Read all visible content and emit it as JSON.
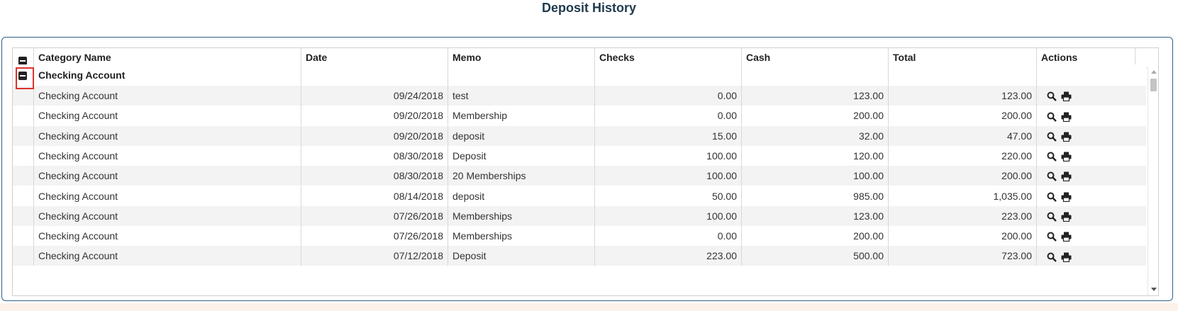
{
  "page": {
    "title": "Deposit History"
  },
  "grid": {
    "columns": {
      "category": "Category Name",
      "date": "Date",
      "memo": "Memo",
      "checks": "Checks",
      "cash": "Cash",
      "total": "Total",
      "actions": "Actions"
    },
    "group": {
      "label": "Checking Account"
    },
    "rows": [
      {
        "category": "Checking Account",
        "date": "09/24/2018",
        "memo": "test",
        "checks": "0.00",
        "cash": "123.00",
        "total": "123.00"
      },
      {
        "category": "Checking Account",
        "date": "09/20/2018",
        "memo": "Membership",
        "checks": "0.00",
        "cash": "200.00",
        "total": "200.00"
      },
      {
        "category": "Checking Account",
        "date": "09/20/2018",
        "memo": "deposit",
        "checks": "15.00",
        "cash": "32.00",
        "total": "47.00"
      },
      {
        "category": "Checking Account",
        "date": "08/30/2018",
        "memo": "Deposit",
        "checks": "100.00",
        "cash": "120.00",
        "total": "220.00"
      },
      {
        "category": "Checking Account",
        "date": "08/30/2018",
        "memo": "20 Memberships",
        "checks": "100.00",
        "cash": "100.00",
        "total": "200.00"
      },
      {
        "category": "Checking Account",
        "date": "08/14/2018",
        "memo": "deposit",
        "checks": "50.00",
        "cash": "985.00",
        "total": "1,035.00"
      },
      {
        "category": "Checking Account",
        "date": "07/26/2018",
        "memo": "Memberships",
        "checks": "100.00",
        "cash": "123.00",
        "total": "223.00"
      },
      {
        "category": "Checking Account",
        "date": "07/26/2018",
        "memo": "Memberships",
        "checks": "0.00",
        "cash": "200.00",
        "total": "200.00"
      },
      {
        "category": "Checking Account",
        "date": "07/12/2018",
        "memo": "Deposit",
        "checks": "223.00",
        "cash": "500.00",
        "total": "723.00"
      }
    ],
    "icons": {
      "view": "search-icon",
      "print": "printer-icon",
      "collapse": "collapse-icon"
    }
  },
  "colors": {
    "accent": "#2f5f86",
    "highlight": "#d9342b",
    "title": "#1f3a4d"
  }
}
